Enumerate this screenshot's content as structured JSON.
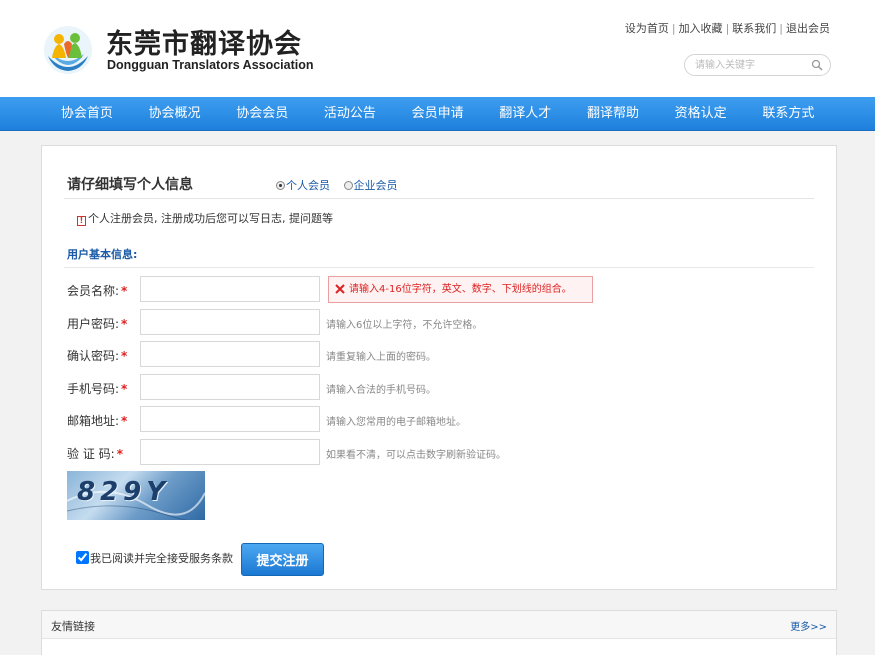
{
  "header": {
    "logo_cn": "东莞市翻译协会",
    "logo_en": "Dongguan Translators Association",
    "top_links": [
      "设为首页",
      "加入收藏",
      "联系我们",
      "退出会员"
    ],
    "search_placeholder": "请输入关键字"
  },
  "nav": [
    "协会首页",
    "协会概况",
    "协会会员",
    "活动公告",
    "会员申请",
    "翻译人才",
    "翻译帮助",
    "资格认定",
    "联系方式"
  ],
  "form": {
    "title": "请仔细填写个人信息",
    "member_types": [
      "个人会员",
      "企业会员"
    ],
    "selected_type": "个人会员",
    "notice": "个人注册会员, 注册成功后您可以写日志, 提问题等",
    "section_title": "用户基本信息:",
    "fields": [
      {
        "label": "会员名称:",
        "value": "",
        "hint": "",
        "error": "请输入4-16位字符，英文、数字、下划线的组合。"
      },
      {
        "label": "用户密码:",
        "value": "",
        "hint": "请输入6位以上字符，不允许空格。"
      },
      {
        "label": "确认密码:",
        "value": "",
        "hint": "请重复输入上面的密码。"
      },
      {
        "label": "手机号码:",
        "value": "",
        "hint": "请输入合法的手机号码。"
      },
      {
        "label": "邮箱地址:",
        "value": "",
        "hint": "请输入您常用的电子邮箱地址。"
      },
      {
        "label": "验 证 码:",
        "value": "",
        "hint": "如果看不清，可以点击数字刷新验证码。"
      }
    ],
    "captcha_text": "829Y",
    "agree_text": "我已阅读并完全接受服务条款",
    "agree_checked": true,
    "submit_label": "提交注册"
  },
  "friend_links": {
    "title": "友情链接",
    "more": "更多>>"
  },
  "colors": {
    "nav_blue": "#2a8ae4",
    "error_red": "#d22",
    "link_blue": "#1a5aa8"
  }
}
